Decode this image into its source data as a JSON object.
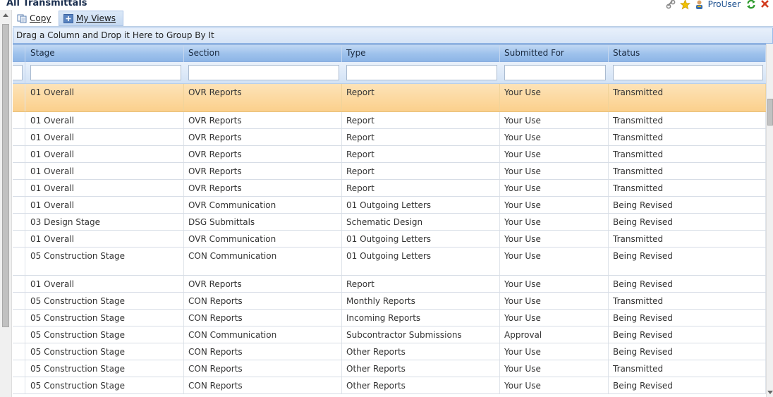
{
  "page": {
    "title": "All Transmittals"
  },
  "user": {
    "name": "ProUser"
  },
  "icons": {
    "link": "link-icon",
    "favorite": "star-icon",
    "user": "user-icon",
    "refresh": "refresh-icon",
    "close": "close-icon",
    "copy": "copy-icon",
    "add": "plus-icon"
  },
  "colors": {
    "header_blue": "#9ec2ec",
    "selected_row": "#fbd08c",
    "title": "#1b2f4f",
    "star": "#f2c200",
    "refresh": "#2e9b2e",
    "close": "#d23b1e"
  },
  "toolbar": {
    "copy_label": "Copy",
    "my_views_label": "My Views"
  },
  "group_panel": {
    "text": "Drag a Column and Drop it Here to Group By It"
  },
  "columns": [
    "Stage",
    "Section",
    "Type",
    "Submitted For",
    "Status"
  ],
  "rows": [
    [
      "01 Overall",
      "OVR Reports",
      "Report",
      "Your Use",
      "Transmitted"
    ],
    [
      "01 Overall",
      "OVR Reports",
      "Report",
      "Your Use",
      "Transmitted"
    ],
    [
      "01 Overall",
      "OVR Reports",
      "Report",
      "Your Use",
      "Transmitted"
    ],
    [
      "01 Overall",
      "OVR Reports",
      "Report",
      "Your Use",
      "Transmitted"
    ],
    [
      "01 Overall",
      "OVR Reports",
      "Report",
      "Your Use",
      "Transmitted"
    ],
    [
      "01 Overall",
      "OVR Reports",
      "Report",
      "Your Use",
      "Transmitted"
    ],
    [
      "01 Overall",
      "OVR Communication",
      "01 Outgoing Letters",
      "Your Use",
      "Being Revised"
    ],
    [
      "03 Design Stage",
      "DSG Submittals",
      "Schematic Design",
      "Your Use",
      "Being Revised"
    ],
    [
      "01 Overall",
      "OVR Communication",
      "01 Outgoing Letters",
      "Your Use",
      "Transmitted"
    ],
    [
      "05 Construction Stage",
      "CON Communication",
      "01 Outgoing Letters",
      "Your Use",
      "Being Revised"
    ],
    [
      "01 Overall",
      "OVR Reports",
      "Report",
      "Your Use",
      "Being Revised"
    ],
    [
      "05 Construction Stage",
      "CON Reports",
      "Monthly Reports",
      "Your Use",
      "Transmitted"
    ],
    [
      "05 Construction Stage",
      "CON Reports",
      "Incoming Reports",
      "Your Use",
      "Being Revised"
    ],
    [
      "05 Construction Stage",
      "CON Communication",
      "Subcontractor Submissions",
      "Approval",
      "Being Revised"
    ],
    [
      "05 Construction Stage",
      "CON Reports",
      "Other Reports",
      "Your Use",
      "Being Revised"
    ],
    [
      "05 Construction Stage",
      "CON Reports",
      "Other Reports",
      "Your Use",
      "Transmitted"
    ],
    [
      "05 Construction Stage",
      "CON Reports",
      "Other Reports",
      "Your Use",
      "Being Revised"
    ]
  ]
}
